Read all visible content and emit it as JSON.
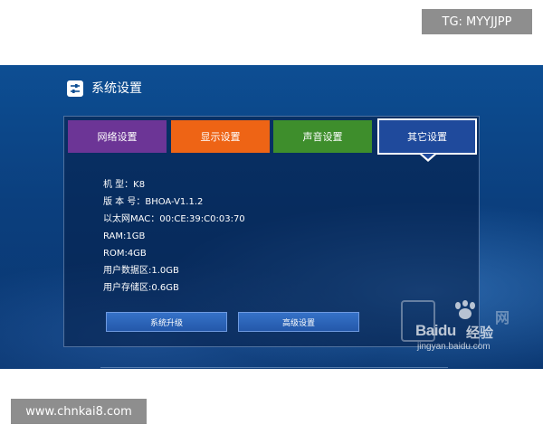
{
  "overlay": {
    "tg_label": "TG: MYYJJPP",
    "site_label": "www.chnkai8.com"
  },
  "window": {
    "title": "系统设置",
    "icon": "settings-sliders-icon"
  },
  "tabs": [
    {
      "label": "网络设置",
      "color": "#6c3596",
      "selected": false
    },
    {
      "label": "显示设置",
      "color": "#ee6415",
      "selected": false
    },
    {
      "label": "声音设置",
      "color": "#3e8e2c",
      "selected": false
    },
    {
      "label": "其它设置",
      "color": "#1f4a9c",
      "selected": true
    }
  ],
  "info": [
    "机 型：K8",
    "版 本 号：BHOA-V1.1.2",
    "以太网MAC：00:CE:39:C0:03:70",
    "RAM:1GB",
    "ROM:4GB",
    "用户数据区:1.0GB",
    "用户存储区:0.6GB"
  ],
  "buttons": {
    "upgrade_label": "系统升级",
    "advanced_label": "高级设置"
  },
  "watermark": {
    "brand": "Baidu",
    "product": "经验",
    "site": "网",
    "url": "jingyan.baidu.com"
  }
}
